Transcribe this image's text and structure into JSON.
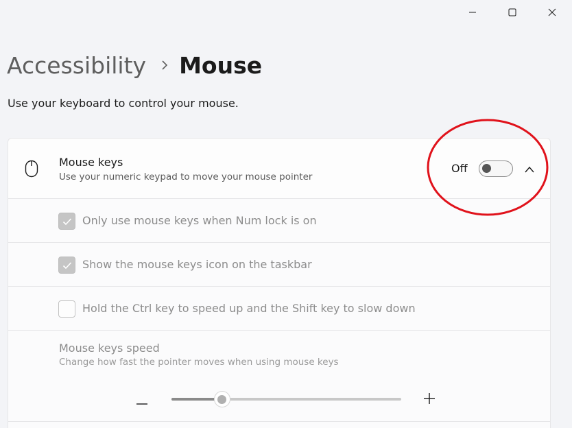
{
  "window": {
    "controls": {
      "minimize": "minimize-icon",
      "maximize": "maximize-icon",
      "close": "close-icon"
    }
  },
  "header": {
    "breadcrumb_parent": "Accessibility",
    "breadcrumb_current": "Mouse",
    "description": "Use your keyboard to control your mouse."
  },
  "mouse_keys": {
    "title": "Mouse keys",
    "subtitle": "Use your numeric keypad to move your mouse pointer",
    "toggle_state": "Off",
    "toggle_on": false,
    "icon": "mouse-icon",
    "expand_icon": "chevron-up-icon"
  },
  "options": [
    {
      "label": "Only use mouse keys when Num lock is on",
      "checked": true
    },
    {
      "label": "Show the mouse keys icon on the taskbar",
      "checked": true
    },
    {
      "label": "Hold the Ctrl key to speed up and the Shift key to slow down",
      "checked": false
    }
  ],
  "speed": {
    "title": "Mouse keys speed",
    "subtitle": "Change how fast the pointer moves when using mouse keys",
    "value_fraction": 0.22
  },
  "colors": {
    "background": "#f3f4f7",
    "panel": "#fbfbfc",
    "annotation": "#e0121b",
    "disabled_text": "#8c8c8c"
  }
}
